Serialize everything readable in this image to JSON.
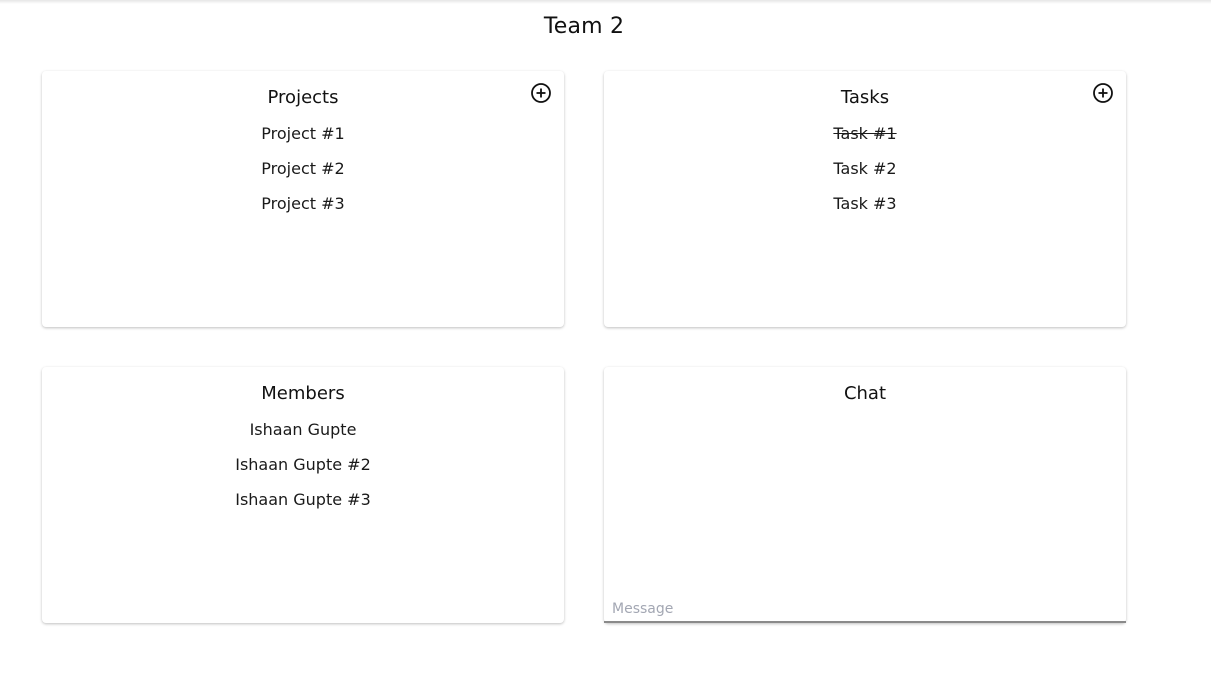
{
  "page": {
    "title": "Team 2"
  },
  "projects": {
    "title": "Projects",
    "add_icon": "plus-circle-icon",
    "items": [
      {
        "label": "Project #1"
      },
      {
        "label": "Project #2"
      },
      {
        "label": "Project #3"
      }
    ]
  },
  "tasks": {
    "title": "Tasks",
    "add_icon": "plus-circle-icon",
    "items": [
      {
        "label": "Task #1",
        "completed": true
      },
      {
        "label": "Task #2",
        "completed": false
      },
      {
        "label": "Task #3",
        "completed": false
      }
    ]
  },
  "members": {
    "title": "Members",
    "items": [
      {
        "name": "Ishaan Gupte"
      },
      {
        "name": "Ishaan Gupte #2"
      },
      {
        "name": "Ishaan Gupte #3"
      }
    ]
  },
  "chat": {
    "title": "Chat",
    "input": {
      "placeholder": "Message",
      "value": ""
    }
  },
  "colors": {
    "text": "#1a1a1a",
    "placeholder": "#a3a7b3",
    "input_underline": "#8a8a8a"
  }
}
